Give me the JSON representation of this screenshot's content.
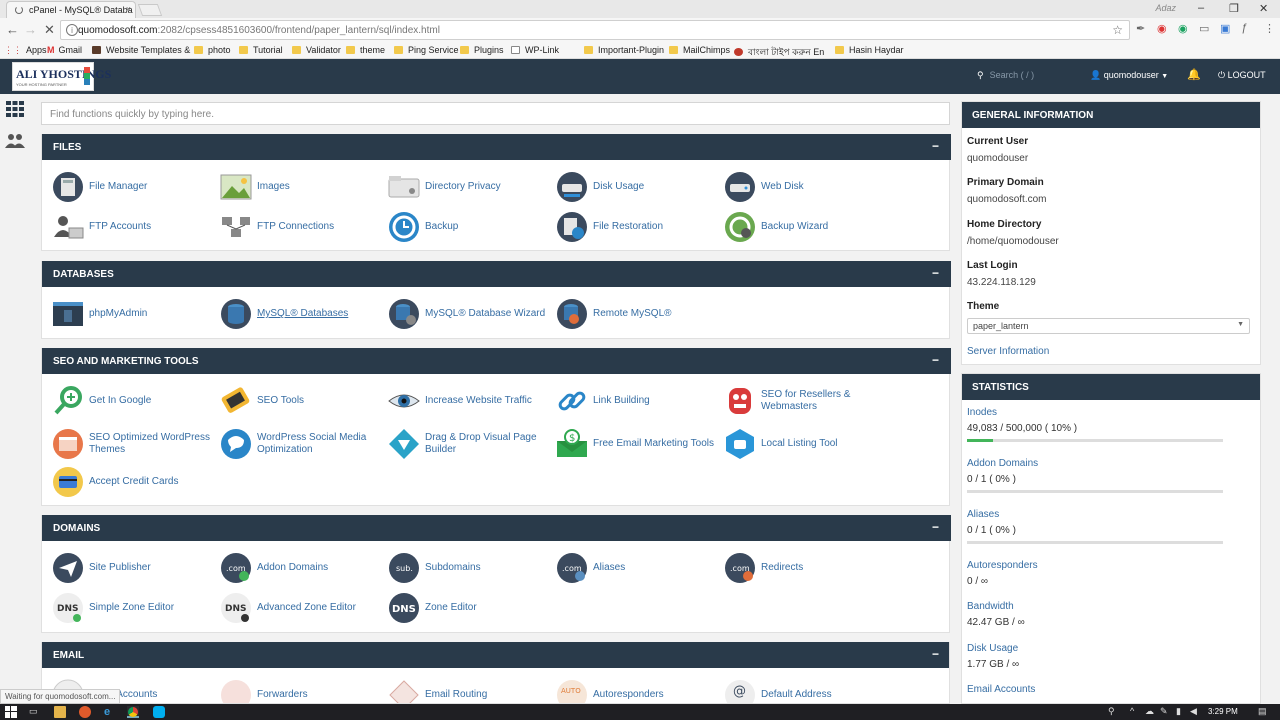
{
  "browser": {
    "tab_title": "cPanel - MySQL® Databa",
    "tab_close": "×",
    "profile": "Adaz",
    "window_controls": [
      "–",
      "❐",
      "✕"
    ],
    "url_host": "quomodosoft.com",
    "url_path": ":2082/cpsess4851603600/frontend/paper_lantern/sql/index.html",
    "bookmarks": [
      {
        "label": "Apps",
        "icon": "apps-grid-icon"
      },
      {
        "label": "Gmail",
        "icon": "gmail-icon"
      },
      {
        "label": "Website Templates &",
        "icon": "page-icon"
      },
      {
        "label": "photo",
        "icon": "folder-icon"
      },
      {
        "label": "Tutorial",
        "icon": "folder-icon"
      },
      {
        "label": "Validator",
        "icon": "folder-icon"
      },
      {
        "label": "theme",
        "icon": "folder-icon"
      },
      {
        "label": "Ping Service",
        "icon": "folder-icon"
      },
      {
        "label": "Plugins",
        "icon": "folder-icon"
      },
      {
        "label": "WP-Link",
        "icon": "page-icon"
      },
      {
        "label": "Important-Plugin",
        "icon": "folder-icon"
      },
      {
        "label": "MailChimps",
        "icon": "folder-icon"
      },
      {
        "label": "বাংলা টাইপ করুন En",
        "icon": "bangla-icon"
      },
      {
        "label": "Hasin Haydar",
        "icon": "folder-icon"
      }
    ],
    "status_text": "Waiting for quomodosoft.com..."
  },
  "header": {
    "logo_brand": "ALI YHOSTINGS",
    "logo_tagline": "YOUR HOSTING PARTNER",
    "search_placeholder": "Search ( / )",
    "username": "quomodouser",
    "logout": "LOGOUT"
  },
  "main": {
    "find_placeholder": "Find functions quickly by typing here.",
    "collapse_symbol": "−",
    "sections": {
      "files": {
        "title": "FILES",
        "items": [
          {
            "label": "File Manager",
            "icon": "file-manager-icon"
          },
          {
            "label": "Images",
            "icon": "images-icon"
          },
          {
            "label": "Directory Privacy",
            "icon": "directory-privacy-icon"
          },
          {
            "label": "Disk Usage",
            "icon": "disk-usage-icon"
          },
          {
            "label": "Web Disk",
            "icon": "web-disk-icon"
          },
          {
            "label": "FTP Accounts",
            "icon": "ftp-accounts-icon"
          },
          {
            "label": "FTP Connections",
            "icon": "ftp-connections-icon"
          },
          {
            "label": "Backup",
            "icon": "backup-icon"
          },
          {
            "label": "File Restoration",
            "icon": "file-restoration-icon"
          },
          {
            "label": "Backup Wizard",
            "icon": "backup-wizard-icon"
          }
        ]
      },
      "databases": {
        "title": "DATABASES",
        "items": [
          {
            "label": "phpMyAdmin",
            "icon": "phpmyadmin-icon"
          },
          {
            "label": "MySQL® Databases",
            "icon": "mysql-databases-icon"
          },
          {
            "label": "MySQL® Database Wizard",
            "icon": "mysql-wizard-icon"
          },
          {
            "label": "Remote MySQL®",
            "icon": "remote-mysql-icon"
          }
        ]
      },
      "seo": {
        "title": "SEO AND MARKETING TOOLS",
        "items": [
          {
            "label": "Get In Google",
            "icon": "get-in-google-icon"
          },
          {
            "label": "SEO Tools",
            "icon": "seo-tools-icon"
          },
          {
            "label": "Increase Website Traffic",
            "icon": "website-traffic-icon"
          },
          {
            "label": "Link Building",
            "icon": "link-building-icon"
          },
          {
            "label": "SEO for Resellers & Webmasters",
            "icon": "seo-resellers-icon"
          },
          {
            "label": "SEO Optimized WordPress Themes",
            "icon": "wp-themes-icon"
          },
          {
            "label": "WordPress Social Media Optimization",
            "icon": "wp-social-icon"
          },
          {
            "label": "Drag & Drop Visual Page Builder",
            "icon": "page-builder-icon"
          },
          {
            "label": "Free Email Marketing Tools",
            "icon": "email-marketing-icon"
          },
          {
            "label": "Local Listing Tool",
            "icon": "local-listing-icon"
          },
          {
            "label": "Accept Credit Cards",
            "icon": "credit-cards-icon"
          }
        ]
      },
      "domains": {
        "title": "DOMAINS",
        "items": [
          {
            "label": "Site Publisher",
            "icon": "site-publisher-icon"
          },
          {
            "label": "Addon Domains",
            "icon": "addon-domains-icon"
          },
          {
            "label": "Subdomains",
            "icon": "subdomains-icon"
          },
          {
            "label": "Aliases",
            "icon": "aliases-icon"
          },
          {
            "label": "Redirects",
            "icon": "redirects-icon"
          },
          {
            "label": "Simple Zone Editor",
            "icon": "simple-zone-editor-icon"
          },
          {
            "label": "Advanced Zone Editor",
            "icon": "advanced-zone-editor-icon"
          },
          {
            "label": "Zone Editor",
            "icon": "zone-editor-icon"
          }
        ]
      },
      "email": {
        "title": "EMAIL",
        "items": [
          {
            "label": "Email Accounts",
            "icon": "email-accounts-icon"
          },
          {
            "label": "Forwarders",
            "icon": "forwarders-icon"
          },
          {
            "label": "Email Routing",
            "icon": "email-routing-icon"
          },
          {
            "label": "Autoresponders",
            "icon": "autoresponders-icon"
          },
          {
            "label": "Default Address",
            "icon": "default-address-icon"
          }
        ]
      }
    }
  },
  "sidebar": {
    "general_title": "GENERAL INFORMATION",
    "current_user_label": "Current User",
    "current_user": "quomodouser",
    "primary_domain_label": "Primary Domain",
    "primary_domain": "quomodosoft.com",
    "home_dir_label": "Home Directory",
    "home_dir": "/home/quomodouser",
    "last_login_label": "Last Login",
    "last_login": "43.224.118.129",
    "theme_label": "Theme",
    "theme_value": "paper_lantern",
    "server_info": "Server Information",
    "statistics_title": "STATISTICS",
    "stats": [
      {
        "label": "Inodes",
        "value": "49,083 / 500,000 ( 10% )",
        "percent": 10
      },
      {
        "label": "Addon Domains",
        "value": "0 / 1 ( 0% )",
        "percent": 0
      },
      {
        "label": "Aliases",
        "value": "0 / 1 ( 0% )",
        "percent": 0
      },
      {
        "label": "Autoresponders",
        "value": "0 / ∞"
      },
      {
        "label": "Bandwidth",
        "value": "42.47 GB / ∞"
      },
      {
        "label": "Disk Usage",
        "value": "1.77 GB / ∞"
      },
      {
        "label": "Email Accounts",
        "value": ""
      }
    ]
  },
  "taskbar": {
    "clock": "3:29 PM"
  },
  "colors": {
    "header_bg": "#293a4a",
    "link": "#366da3",
    "progress": "#43b55a"
  }
}
